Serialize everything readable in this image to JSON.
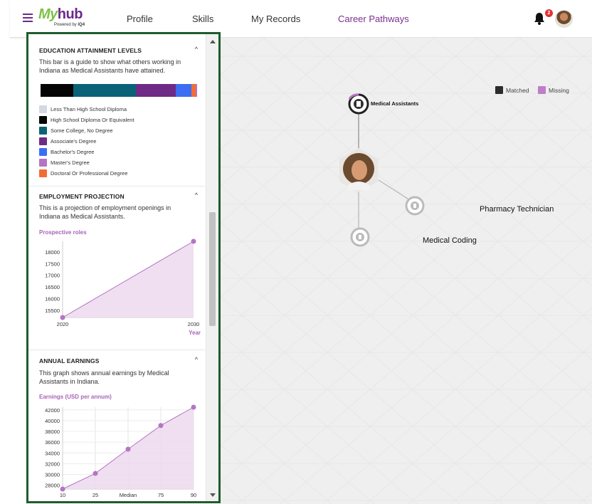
{
  "header": {
    "logo_text_1": "My",
    "logo_text_2": "hub",
    "logo_sub": "Powered by",
    "logo_sub_brand": "iQ4",
    "nav": [
      {
        "label": "Profile"
      },
      {
        "label": "Skills"
      },
      {
        "label": "My Records"
      },
      {
        "label": "Career Pathways",
        "active": true
      }
    ],
    "notifications_count": "2"
  },
  "education": {
    "title": "EDUCATION ATTAINMENT LEVELS",
    "toggle": "^",
    "description": "This bar is a guide to show what others working in Indiana as Medical Assistants have attained.",
    "segments": [
      {
        "label": "Less Than High School Diploma",
        "color": "#d4d8e3",
        "share": 0.01
      },
      {
        "label": "High School Diploma Or Equivalent",
        "color": "#050505",
        "share": 0.205
      },
      {
        "label": "Some College, No Degree",
        "color": "#0a6277",
        "share": 0.4
      },
      {
        "label": "Associate's Degree",
        "color": "#6f2a86",
        "share": 0.25
      },
      {
        "label": "Bachelor's Degree",
        "color": "#3b6ef2",
        "share": 0.1
      },
      {
        "label": "Master's Degree",
        "color": "#b575c3",
        "share": 0.01
      },
      {
        "label": "Doctoral Or Professional Degree",
        "color": "#f26d33",
        "share": 0.025
      }
    ]
  },
  "employment": {
    "title": "EMPLOYMENT PROJECTION",
    "toggle": "^",
    "description": "This is a projection of employment openings in Indiana as Medical Assistants.",
    "ylabel": "Prospective roles",
    "xlabel": "Year"
  },
  "earnings": {
    "title": "ANNUAL EARNINGS",
    "toggle": "^",
    "description": "This graph shows annual earnings by Medical Assistants in Indiana.",
    "ylabel": "Earnings (USD per annum)"
  },
  "chart_data": [
    {
      "type": "area",
      "title": "",
      "ylabel": "Prospective roles",
      "xlabel": "Year",
      "x": [
        2020,
        2030
      ],
      "values": [
        15200,
        18450
      ],
      "ylim": [
        15200,
        18450
      ],
      "yticks": [
        15500,
        16000,
        16500,
        17000,
        17500,
        18000
      ],
      "xtick_labels": [
        "2020",
        "2030"
      ],
      "grid": false
    },
    {
      "type": "area",
      "title": "",
      "ylabel": "Earnings (USD per annum)",
      "categories": [
        "10",
        "25",
        "Median",
        "75",
        "90"
      ],
      "values": [
        27300,
        30200,
        34700,
        39100,
        42500
      ],
      "ylim": [
        27300,
        42500
      ],
      "yticks": [
        28000,
        30000,
        32000,
        34000,
        36000,
        38000,
        40000,
        42000
      ],
      "grid": true
    }
  ],
  "map": {
    "legend": [
      {
        "label": "Matched",
        "color": "#2b2b2b"
      },
      {
        "label": "Missing",
        "color": "#c07dc9"
      }
    ],
    "nodes": [
      {
        "label": "Medical Assistants"
      },
      {
        "label": "Pharmacy Technician"
      },
      {
        "label": "Medical Coding"
      }
    ]
  }
}
